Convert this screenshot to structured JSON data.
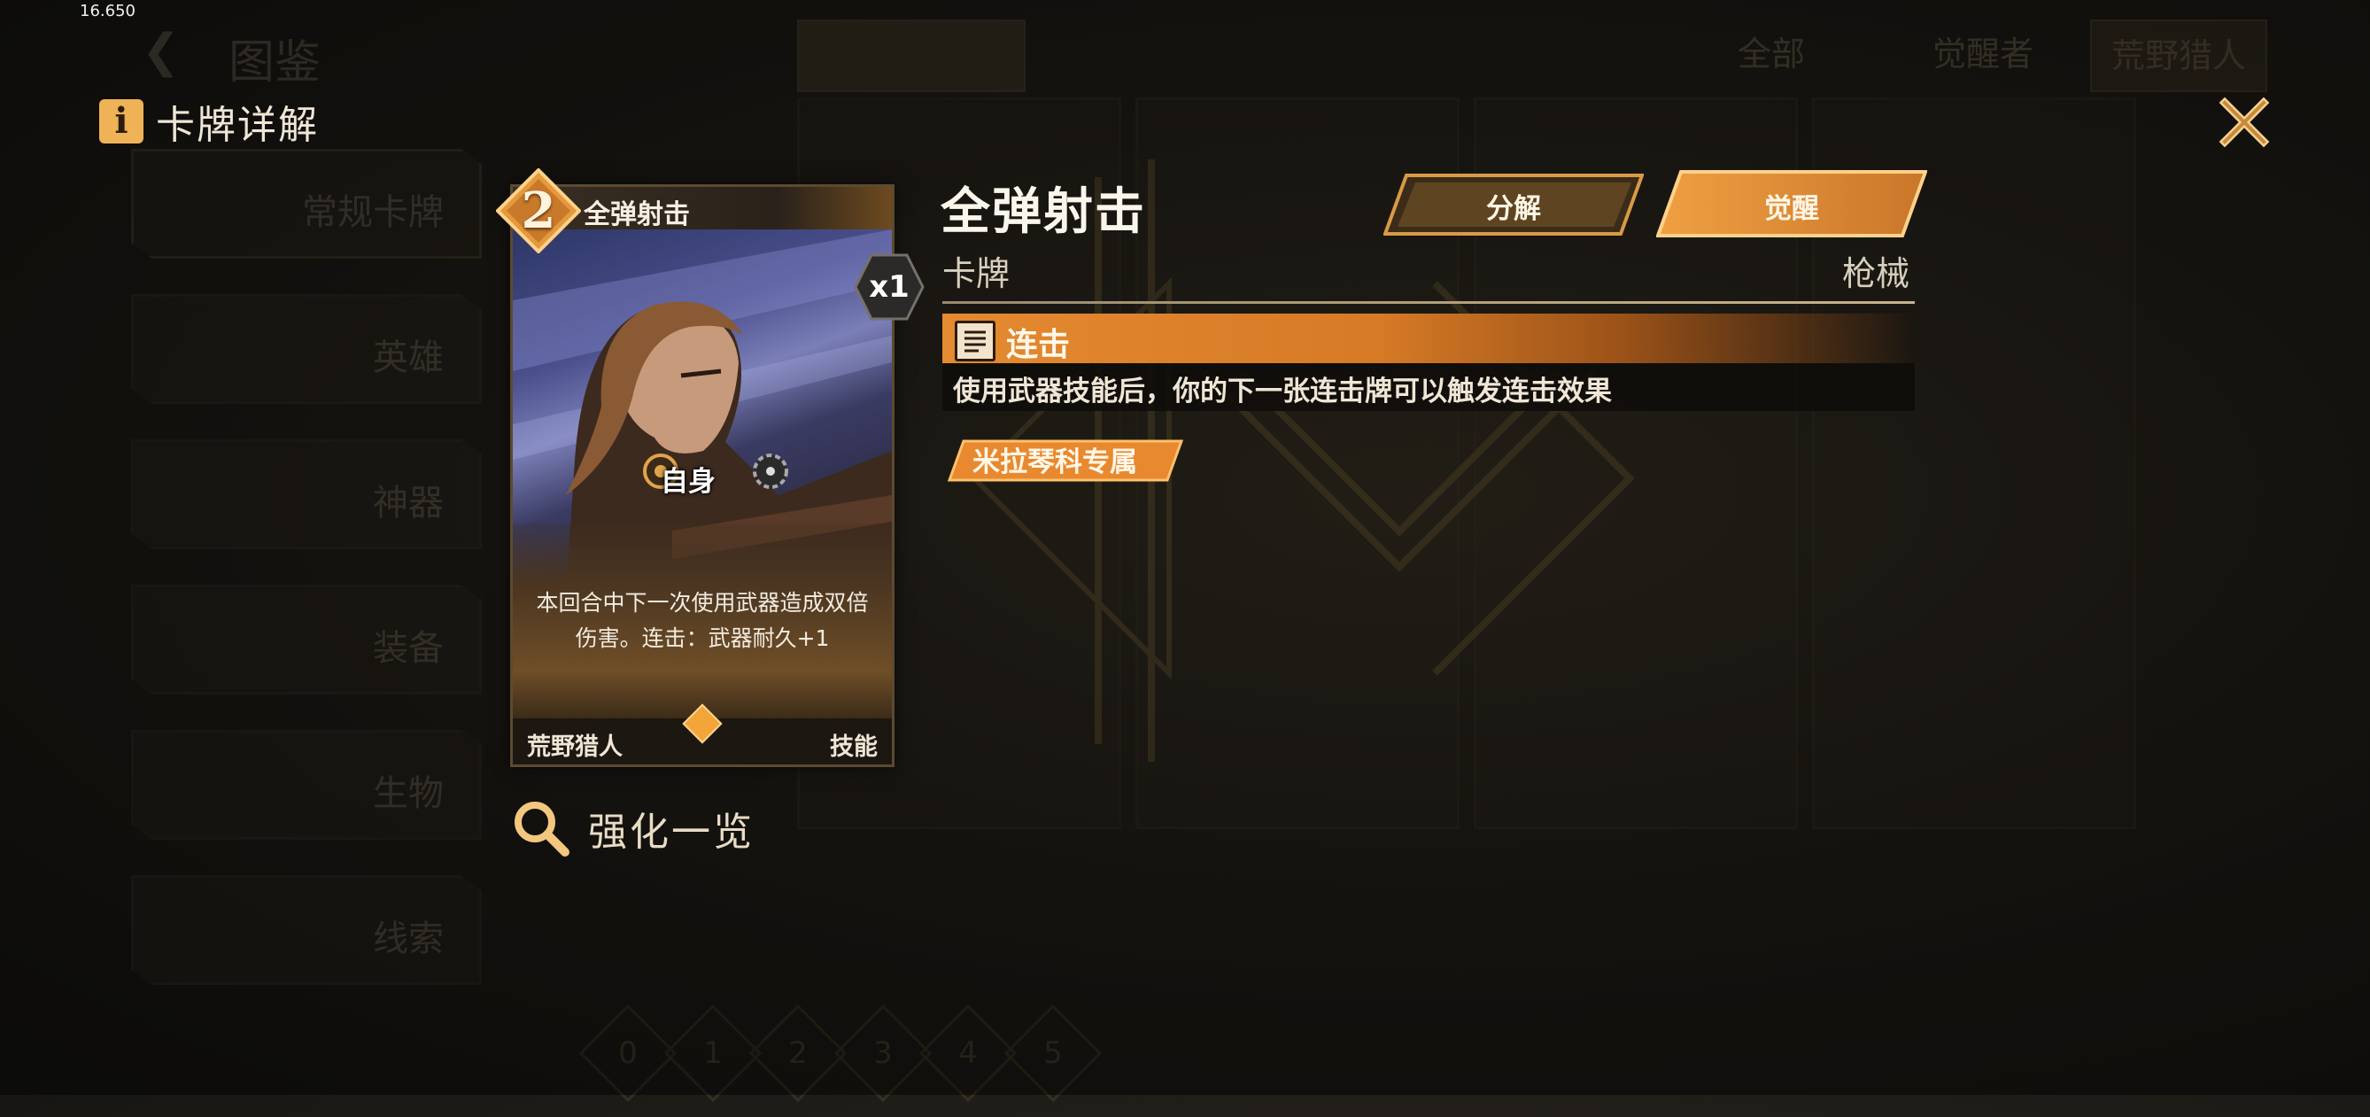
{
  "fps": "16.650",
  "panel": {
    "title": "卡牌详解",
    "info_glyph": "i"
  },
  "card": {
    "cost": "2",
    "name": "全弹射击",
    "count": "x1",
    "target": "自身",
    "description_line1": "本回合中下一次使用武器造成双倍",
    "description_line2": "伤害。连击：武器耐久+1",
    "class": "荒野猎人",
    "type": "技能"
  },
  "enhance": {
    "label": "强化一览"
  },
  "detail": {
    "title": "全弹射击",
    "category": "卡牌",
    "attribute": "枪械",
    "decompose_label": "分解",
    "awaken_label": "觉醒",
    "keyword": {
      "name": "连击",
      "description": "使用武器技能后，你的下一张连击牌可以触发连击效果"
    },
    "exclusive_tag": "米拉琴科专属"
  },
  "background": {
    "nav_title": "图鉴",
    "filters": [
      "全部",
      "觉醒者",
      "荒野猎人"
    ],
    "side_tabs": [
      "常规卡牌",
      "英雄",
      "神器",
      "装备",
      "生物",
      "线索"
    ],
    "pages": [
      "0",
      "1",
      "2",
      "3",
      "4",
      "5"
    ]
  },
  "colors": {
    "accent_orange": "#e48a30",
    "gold": "#f0b257",
    "panel_dark": "#151412"
  }
}
